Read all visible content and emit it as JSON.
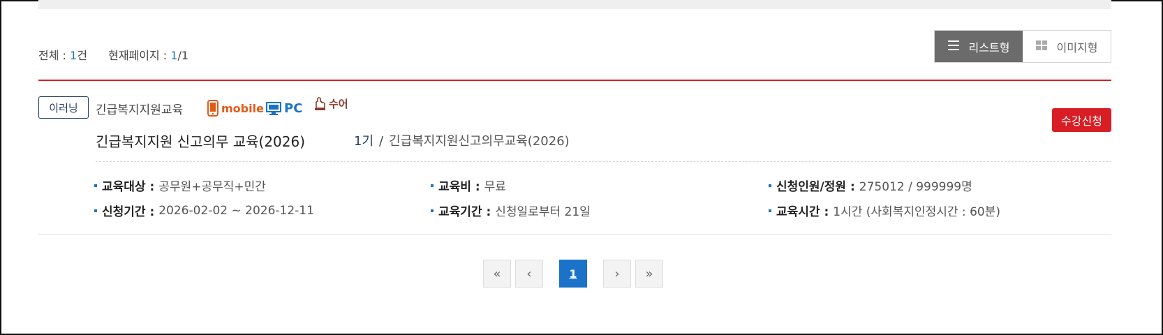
{
  "summary": {
    "total_label": "전체 :",
    "total_count": "1",
    "total_unit": "건",
    "page_label": "현재페이지 :",
    "current_page": "1",
    "page_sep": "/1"
  },
  "view_toggle": {
    "list_label": "리스트형",
    "image_label": "이미지형"
  },
  "course": {
    "type_badge": "이러닝",
    "category": "긴급복지지원교육",
    "devices": {
      "mobile": "mobile",
      "pc": "PC",
      "sign": "수어"
    },
    "apply_label": "수강신청",
    "title": "긴급복지지원 신고의무 교육(2026)",
    "term": "1기",
    "term_sep": "/",
    "term_name": "긴급복지지원신고의무교육(2026)",
    "info": {
      "target_label": "교육대상 :",
      "target_value": "공무원+공무직+민간",
      "fee_label": "교육비 :",
      "fee_value": "무료",
      "applicants_label": "신청인원/정원 :",
      "applicants_value": "275012 / 999999명",
      "apply_period_label": "신청기간 :",
      "apply_period_value": "2026-02-02 ~ 2026-12-11",
      "edu_period_label": "교육기간 :",
      "edu_period_value": "신청일로부터 21일",
      "edu_time_label": "교육시간 :",
      "edu_time_value": "1시간 (사회복지인정시간 : 60분)"
    }
  },
  "pagination": {
    "first": "«",
    "prev": "‹",
    "current": "1",
    "next": "›",
    "last": "»"
  },
  "colors": {
    "accent_red": "#d81e24",
    "accent_blue": "#1a73c9",
    "navy": "#1d3c5c",
    "toggle_active": "#6b6b6b"
  }
}
